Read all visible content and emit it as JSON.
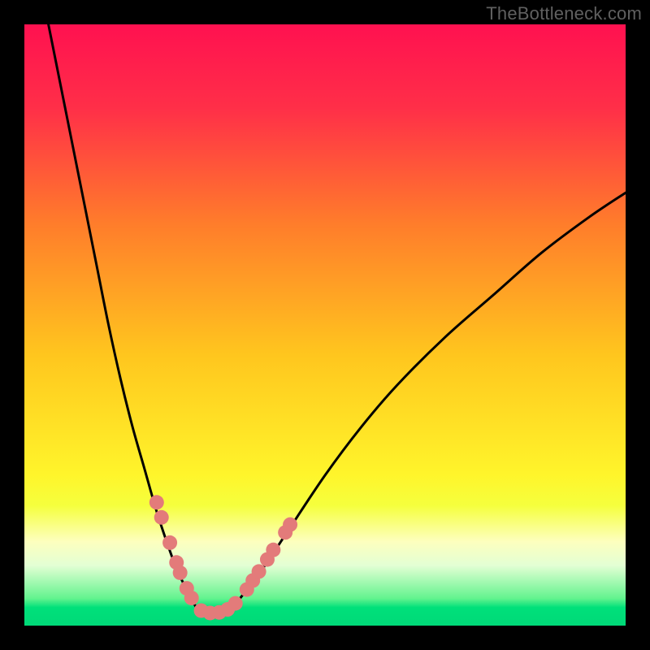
{
  "attribution": "TheBottleneck.com",
  "gradient": {
    "stops": [
      {
        "pct": 0,
        "color": "#FF1150"
      },
      {
        "pct": 14,
        "color": "#FF2F48"
      },
      {
        "pct": 33,
        "color": "#FF7C2B"
      },
      {
        "pct": 55,
        "color": "#FFC61E"
      },
      {
        "pct": 75,
        "color": "#FFF52B"
      },
      {
        "pct": 80,
        "color": "#F5FF3D"
      },
      {
        "pct": 86,
        "color": "#FDFFBE"
      },
      {
        "pct": 90,
        "color": "#E3FFD4"
      },
      {
        "pct": 95.5,
        "color": "#62F38E"
      },
      {
        "pct": 97,
        "color": "#00E07A"
      },
      {
        "pct": 100,
        "color": "#00D978"
      }
    ]
  },
  "chart_data": {
    "type": "line",
    "title": "",
    "xlabel": "",
    "ylabel": "",
    "xlim": [
      0,
      100
    ],
    "ylim": [
      0,
      100
    ],
    "series": [
      {
        "name": "bottleneck-curve-left",
        "x": [
          4,
          6,
          8,
          10,
          12,
          14,
          16,
          18,
          20,
          22,
          24,
          25.5,
          27,
          28,
          29,
          29.8
        ],
        "y": [
          100,
          90,
          80,
          70,
          60,
          50,
          41,
          33,
          26,
          19,
          13,
          9,
          6,
          4,
          2.5,
          2.3
        ]
      },
      {
        "name": "bottleneck-curve-right",
        "x": [
          33.5,
          35,
          37,
          40,
          44,
          50,
          56,
          62,
          70,
          78,
          86,
          94,
          100
        ],
        "y": [
          2.3,
          3.5,
          6,
          10,
          16,
          25,
          33,
          40,
          48,
          55,
          62,
          68,
          72
        ]
      },
      {
        "name": "bottleneck-flat",
        "x": [
          29.8,
          31.6,
          33.5
        ],
        "y": [
          2.3,
          2.0,
          2.3
        ]
      }
    ],
    "markers": {
      "name": "sample-dots",
      "color": "#E37B7A",
      "radius": 9,
      "points": [
        {
          "x": 22.0,
          "y": 20.5
        },
        {
          "x": 22.8,
          "y": 18.0
        },
        {
          "x": 24.2,
          "y": 13.8
        },
        {
          "x": 25.3,
          "y": 10.5
        },
        {
          "x": 25.9,
          "y": 8.8
        },
        {
          "x": 27.0,
          "y": 6.2
        },
        {
          "x": 27.8,
          "y": 4.6
        },
        {
          "x": 29.4,
          "y": 2.5
        },
        {
          "x": 30.9,
          "y": 2.1
        },
        {
          "x": 32.4,
          "y": 2.2
        },
        {
          "x": 33.8,
          "y": 2.7
        },
        {
          "x": 35.1,
          "y": 3.7
        },
        {
          "x": 37.0,
          "y": 6.0
        },
        {
          "x": 38.0,
          "y": 7.5
        },
        {
          "x": 39.0,
          "y": 9.0
        },
        {
          "x": 40.4,
          "y": 11.0
        },
        {
          "x": 41.4,
          "y": 12.6
        },
        {
          "x": 43.4,
          "y": 15.5
        },
        {
          "x": 44.2,
          "y": 16.8
        }
      ]
    }
  }
}
